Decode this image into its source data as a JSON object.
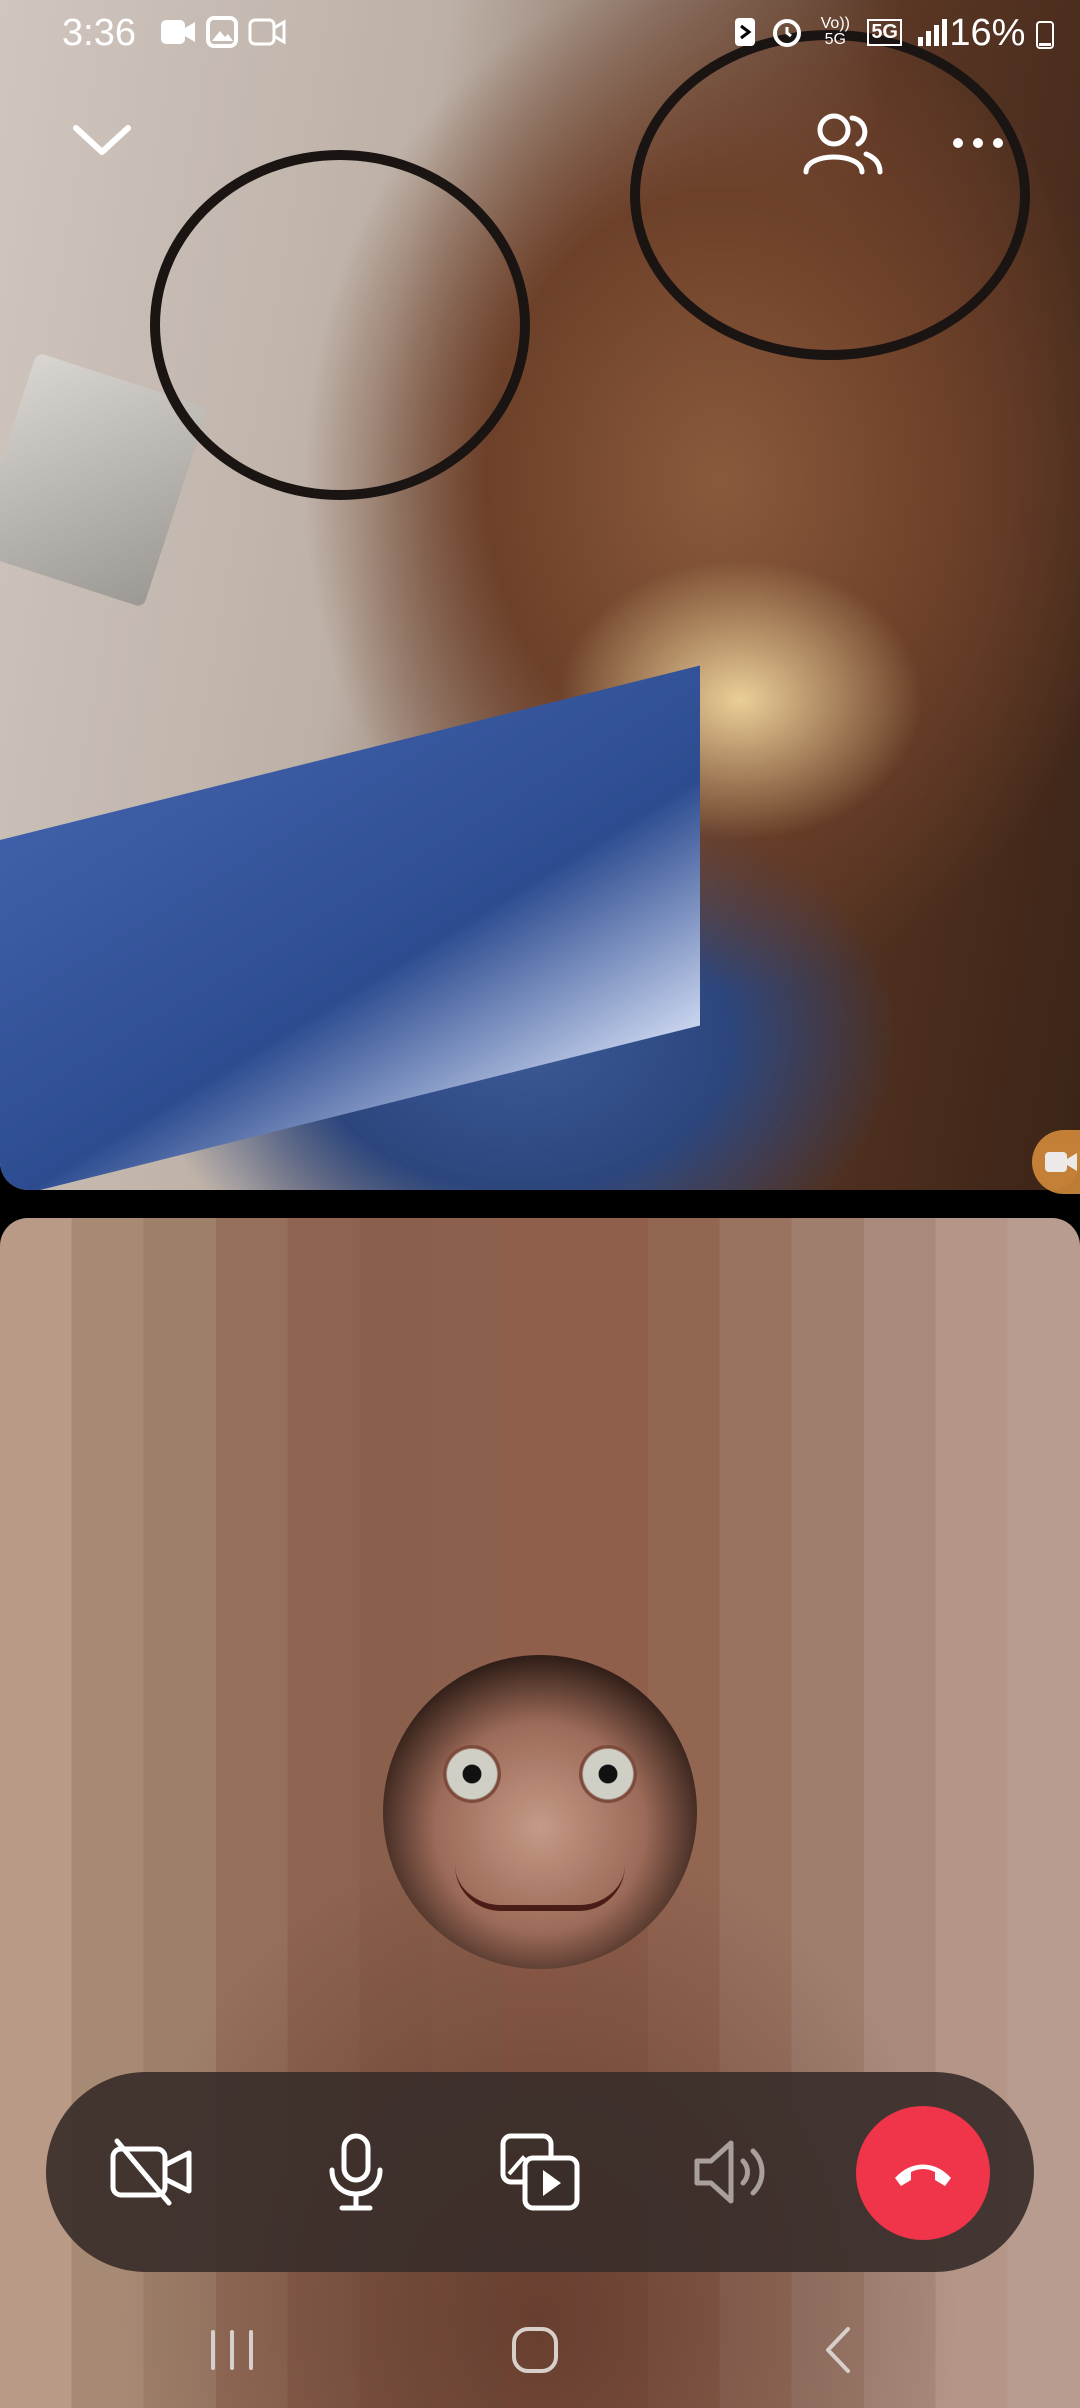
{
  "status_bar": {
    "time": "3:36",
    "battery": "16%",
    "left_icons": [
      "video-call-icon",
      "gallery-icon",
      "screen-record-icon"
    ],
    "right_icons": [
      "nfc-icon",
      "alarm-icon",
      "volte-icon",
      "5g-icon",
      "signal-icon",
      "battery-icon"
    ],
    "volte_text": "Vo)) 5G",
    "network_text": "5G"
  },
  "top_controls": {
    "minimize_icon": "chevron-down-icon",
    "participants_icon": "participants-icon",
    "more_icon": "more-options-icon"
  },
  "call_controls": [
    {
      "name": "camera-off-button",
      "icon": "camera-off-icon"
    },
    {
      "name": "mute-button",
      "icon": "microphone-icon"
    },
    {
      "name": "effects-button",
      "icon": "media-share-icon"
    },
    {
      "name": "speaker-button",
      "icon": "speaker-icon"
    },
    {
      "name": "end-call-button",
      "icon": "end-call-icon"
    }
  ],
  "colors": {
    "end_call": "#f0344a",
    "controls_bg": "#3a2e2a"
  },
  "nav_bar": [
    "recent-apps-icon",
    "home-icon",
    "back-icon"
  ]
}
